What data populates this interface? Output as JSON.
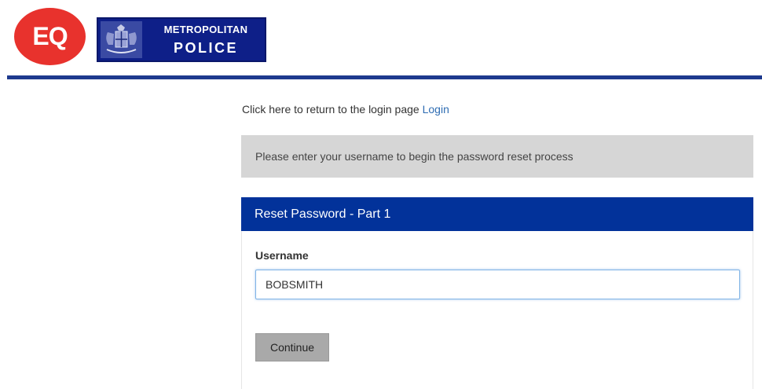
{
  "header": {
    "eq_logo_text": "EQ",
    "met_logo_line1": "METROPOLITAN",
    "met_logo_line2": "POLICE"
  },
  "return_link": {
    "prefix": "Click here to return to the login page",
    "link_text": "Login"
  },
  "info_message": "Please enter your username to begin the password reset process",
  "panel": {
    "title": "Reset Password - Part 1",
    "username_label": "Username",
    "username_value": "BOBSMITH",
    "continue_label": "Continue"
  },
  "colors": {
    "eq_red": "#e8322d",
    "met_blue": "#0e1f88",
    "panel_header_blue": "#02329a",
    "link_blue": "#2f6db3",
    "info_bg": "#d6d6d6",
    "button_gray": "#a9a9a9"
  },
  "icons": {
    "crest": "metropolitan-police-crest-icon"
  }
}
